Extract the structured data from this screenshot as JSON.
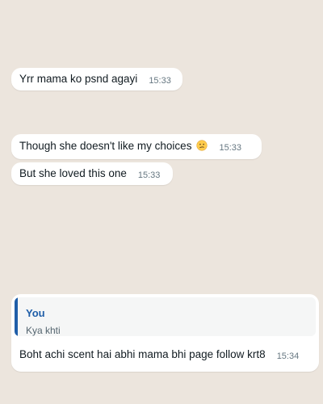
{
  "messages": [
    {
      "text": "Yrr mama ko psnd agayi",
      "time": "15:33"
    },
    {
      "text": "Though she doesn't like my choices",
      "emoji": "confused-face",
      "time": "15:33"
    },
    {
      "text": "But she loved this one",
      "time": "15:33"
    },
    {
      "reply": {
        "author": "You",
        "text": "Kya khti"
      },
      "text": "Boht achi scent hai abhi mama bhi page follow krt8",
      "time": "15:34"
    }
  ],
  "colors": {
    "background": "#ece5dd",
    "bubble": "#ffffff",
    "timestamp": "#667781",
    "quote_accent": "#1f5ea8",
    "emoji_fill": "#ffcc4d"
  }
}
